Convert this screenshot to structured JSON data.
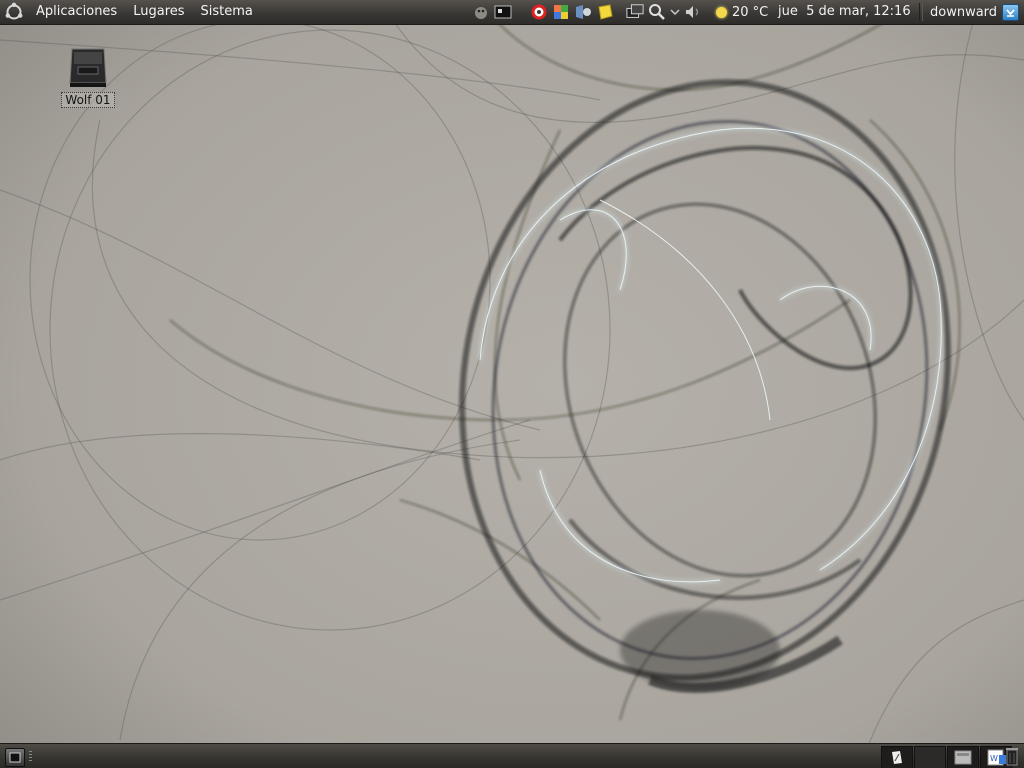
{
  "top_panel": {
    "menus": [
      "Aplicaciones",
      "Lugares",
      "Sistema"
    ],
    "weather": {
      "temp": "20 °C"
    },
    "clock": "jue  5 de mar, 12:16",
    "user": "downward"
  },
  "desktop": {
    "icons": [
      {
        "label": "Wolf 01",
        "icon": "hard-drive-icon"
      }
    ]
  },
  "bottom_panel": {
    "workspaces_count": 4
  },
  "colors": {
    "panel": "#3a3835",
    "wallpaper_base": "#aaa69f",
    "swirl_accent": "#bcd4dc"
  }
}
